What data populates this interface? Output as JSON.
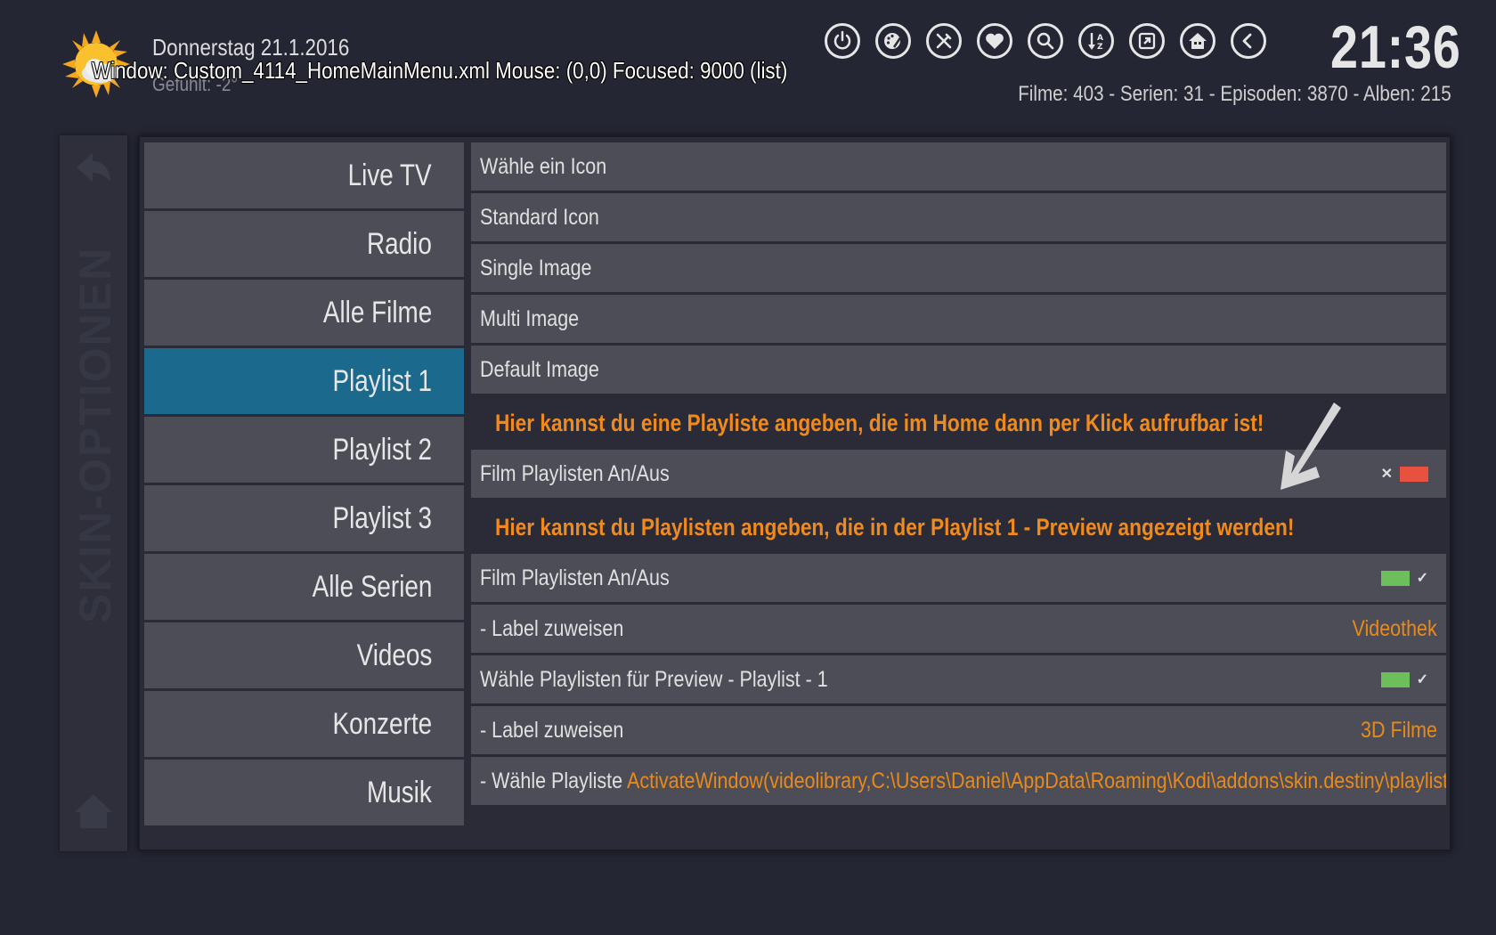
{
  "header": {
    "date": "Donnerstag  21.1.2016",
    "felt": "Gefühlt: -2°",
    "debug": "Window: Custom_4114_HomeMainMenu.xml  Mouse: (0,0)  Focused: 9000 (list)",
    "clock": "21:36",
    "stats": "Filme: 403 - Serien: 31 - Episoden: 3870 - Alben: 215",
    "icons": [
      "power-icon",
      "skin-settings-icon",
      "tools-icon",
      "favourites-icon",
      "search-icon",
      "sort-az-icon",
      "open-window-icon",
      "home-screen-icon",
      "back-icon"
    ]
  },
  "sidebar": {
    "label": "SKIN-OPTIONEN",
    "icons": [
      "back-arrow-icon",
      "home-icon"
    ]
  },
  "menu": {
    "items": [
      {
        "label": "Live TV"
      },
      {
        "label": "Radio"
      },
      {
        "label": "Alle Filme"
      },
      {
        "label": "Playlist 1"
      },
      {
        "label": "Playlist 2"
      },
      {
        "label": "Playlist 3"
      },
      {
        "label": "Alle Serien"
      },
      {
        "label": "Videos"
      },
      {
        "label": "Konzerte"
      },
      {
        "label": "Musik"
      }
    ],
    "active": "Playlist 1"
  },
  "options": {
    "choose_icon": "Wähle ein Icon",
    "standard_icon": "Standard Icon",
    "single_image": "Single Image",
    "multi_image": "Multi Image",
    "default_image": "Default Image",
    "info1": "Hier kannst du eine Playliste angeben, die im Home dann per Klick aufrufbar ist!",
    "film_playlists_1": "Film Playlisten An/Aus",
    "film_playlists_1_state": "off",
    "info2": "Hier kannst du Playlisten angeben, die in der Playlist 1 - Preview angezeigt werden!",
    "film_playlists_2": "Film Playlisten An/Aus",
    "film_playlists_2_state": "on",
    "label_assign_1": " - Label zuweisen",
    "label_assign_1_value": "Videothek",
    "preview_playlists": "Wähle Playlisten für Preview - Playlist - 1",
    "preview_playlists_state": "on",
    "label_assign_2": " - Label zuweisen",
    "label_assign_2_value": "3D Filme",
    "choose_playlist": "- Wähle Playliste",
    "choose_playlist_value": "ActivateWindow(videolibrary,C:\\Users\\Daniel\\AppData\\Roaming\\Kodi\\addons\\skin.destiny\\playlists\\..."
  },
  "colors": {
    "accent_blue": "#1b6a8e",
    "orange": "#f08a1c",
    "toggle_off": "#e8503f",
    "toggle_on": "#6cbf5a"
  }
}
